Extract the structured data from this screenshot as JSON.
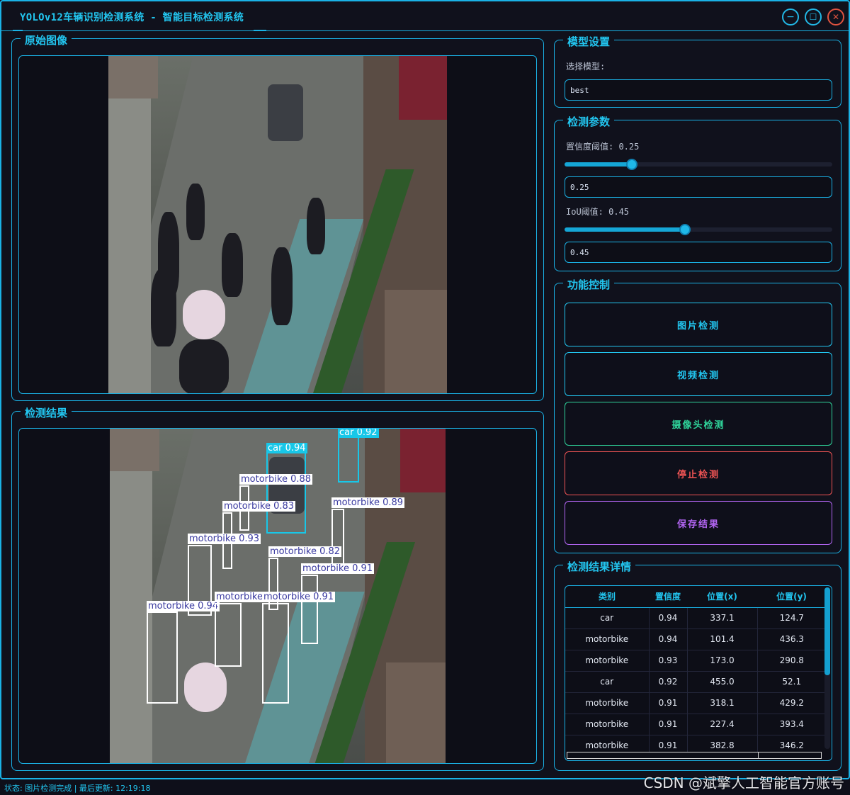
{
  "window": {
    "title": "YOLOv12车辆识别检测系统 - 智能目标检测系统",
    "minimize_icon": "minimize-icon",
    "maximize_icon": "maximize-icon",
    "close_icon": "close-icon",
    "minimize_glyph": "−",
    "maximize_glyph": "☐",
    "close_glyph": "✕"
  },
  "original_panel": {
    "title": "原始图像"
  },
  "result_panel": {
    "title": "检测结果",
    "detections": [
      {
        "label": "car 0.94"
      },
      {
        "label": "car 0.92"
      },
      {
        "label": "motorbike 0.88"
      },
      {
        "label": "motorbike 0.83"
      },
      {
        "label": "motorbike 0.89"
      },
      {
        "label": "motorbike 0.93"
      },
      {
        "label": "motorbike 0.82"
      },
      {
        "label": "motorbike 0.91"
      },
      {
        "label": "motorbike 0.94"
      },
      {
        "label": "motorbike"
      },
      {
        "label": "motorbike 0.91"
      }
    ]
  },
  "model_settings": {
    "title": "模型设置",
    "select_label": "选择模型:",
    "model_value": "best"
  },
  "detect_params": {
    "title": "检测参数",
    "conf_label": "置信度阈值: 0.25",
    "conf_value": "0.25",
    "conf_level": 0.25,
    "iou_label": "IoU阈值: 0.45",
    "iou_value": "0.45",
    "iou_level": 0.45
  },
  "controls": {
    "title": "功能控制",
    "image_detect": "图片检测",
    "video_detect": "视频检测",
    "camera_detect": "摄像头检测",
    "stop_detect": "停止检测",
    "save_result": "保存结果",
    "colors": {
      "image_detect": "#22c6f0",
      "video_detect": "#22c6f0",
      "camera_detect": "#2fd39a",
      "stop_detect": "#f05454",
      "save_result": "#b265f2"
    }
  },
  "details": {
    "title": "检测结果详情",
    "headers": [
      "类别",
      "置信度",
      "位置(x)",
      "位置(y)"
    ],
    "rows": [
      [
        "car",
        "0.94",
        "337.1",
        "124.7"
      ],
      [
        "motorbike",
        "0.94",
        "101.4",
        "436.3"
      ],
      [
        "motorbike",
        "0.93",
        "173.0",
        "290.8"
      ],
      [
        "car",
        "0.92",
        "455.0",
        "52.1"
      ],
      [
        "motorbike",
        "0.91",
        "318.1",
        "429.2"
      ],
      [
        "motorbike",
        "0.91",
        "227.4",
        "393.4"
      ],
      [
        "motorbike",
        "0.91",
        "382.8",
        "346.2"
      ]
    ]
  },
  "status": {
    "text": "状态: 图片检测完成 | 最后更新: 12:19:18"
  },
  "watermark": {
    "text": "CSDN @斌擎人工智能官方账号"
  }
}
